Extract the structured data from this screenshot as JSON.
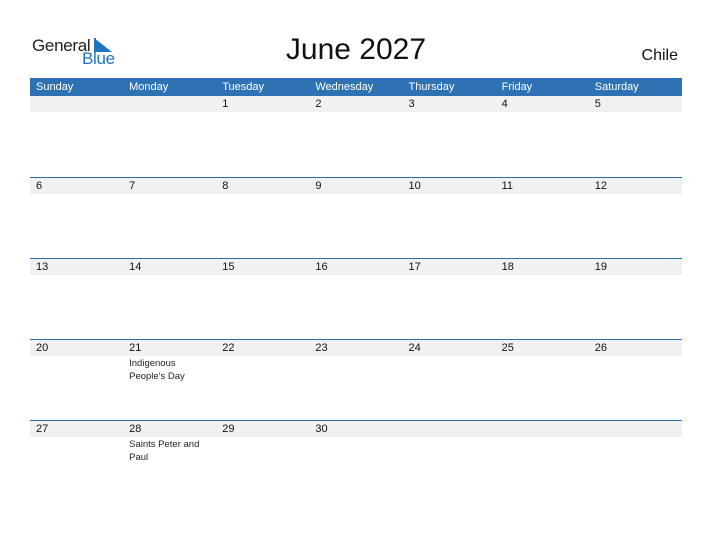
{
  "logo": {
    "line1": "General",
    "line2": "Blue",
    "accent": "#1f74c0"
  },
  "header": {
    "title": "June 2027",
    "country": "Chile"
  },
  "colors": {
    "header_bg": "#2f72b3",
    "strip_bg": "#f1f1f1"
  },
  "weekdays": [
    "Sunday",
    "Monday",
    "Tuesday",
    "Wednesday",
    "Thursday",
    "Friday",
    "Saturday"
  ],
  "weeks": [
    {
      "days": [
        "",
        "",
        "1",
        "2",
        "3",
        "4",
        "5"
      ],
      "events": [
        "",
        "",
        "",
        "",
        "",
        "",
        ""
      ]
    },
    {
      "days": [
        "6",
        "7",
        "8",
        "9",
        "10",
        "11",
        "12"
      ],
      "events": [
        "",
        "",
        "",
        "",
        "",
        "",
        ""
      ]
    },
    {
      "days": [
        "13",
        "14",
        "15",
        "16",
        "17",
        "18",
        "19"
      ],
      "events": [
        "",
        "",
        "",
        "",
        "",
        "",
        ""
      ]
    },
    {
      "days": [
        "20",
        "21",
        "22",
        "23",
        "24",
        "25",
        "26"
      ],
      "events": [
        "",
        "Indigenous People's Day",
        "",
        "",
        "",
        "",
        ""
      ]
    },
    {
      "days": [
        "27",
        "28",
        "29",
        "30",
        "",
        "",
        ""
      ],
      "events": [
        "",
        "Saints Peter and Paul",
        "",
        "",
        "",
        "",
        ""
      ]
    }
  ]
}
